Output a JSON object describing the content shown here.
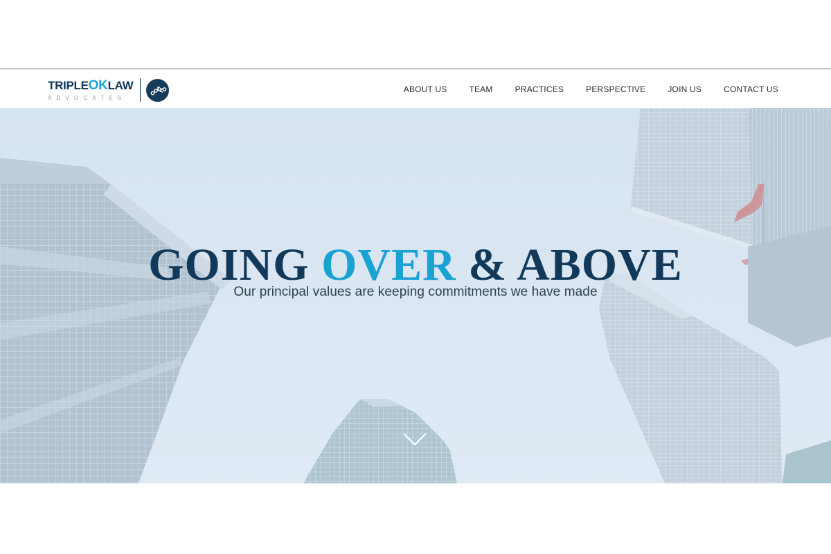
{
  "brand": {
    "name_part1": "TRIPLE",
    "name_part2": "OK",
    "name_part3": "LAW",
    "subtitle": "ADVOCATES",
    "badge_icon": "ookko-circle-logo-icon",
    "colors": {
      "navy": "#0e3654",
      "cyan": "#1aa5d6"
    }
  },
  "nav": {
    "items": [
      {
        "label": "ABOUT US"
      },
      {
        "label": "TEAM"
      },
      {
        "label": "PRACTICES"
      },
      {
        "label": "PERSPECTIVE"
      },
      {
        "label": "JOIN US"
      },
      {
        "label": "CONTACT US"
      }
    ]
  },
  "hero": {
    "headline_part1": "GOING ",
    "headline_accent": "OVER",
    "headline_part2": " & ABOVE",
    "tagline": "Our principal values are keeping commitments we have made",
    "scroll_icon": "chevron-down-icon",
    "colors": {
      "headline": "#12395a",
      "accent": "#19a3d2",
      "sky": "#dce8f3"
    }
  }
}
